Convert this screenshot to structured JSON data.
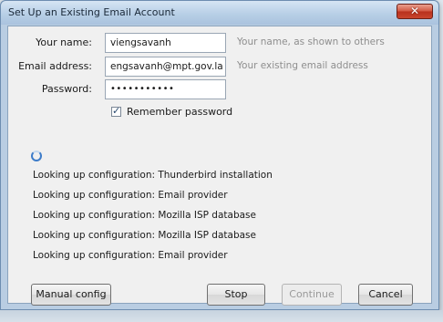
{
  "window": {
    "title": "Set Up an Existing Email Account",
    "close_glyph": "✕"
  },
  "form": {
    "name_label": "Your name:",
    "name_value": "viengsavanh",
    "name_hint": "Your name, as shown to others",
    "email_label": "Email address:",
    "email_value": "engsavanh@mpt.gov.la",
    "email_hint": "Your existing email address",
    "password_label": "Password:",
    "password_value": "•••••••••••",
    "remember_label": "Remember password",
    "remember_checked": true
  },
  "status": {
    "lines": [
      "Looking up configuration: Thunderbird installation",
      "Looking up configuration: Email provider",
      "Looking up configuration: Mozilla ISP database",
      "Looking up configuration: Mozilla ISP database",
      "Looking up configuration: Email provider"
    ]
  },
  "buttons": {
    "manual_config": "Manual config",
    "stop": "Stop",
    "continue": "Continue",
    "cancel": "Cancel"
  },
  "icons": {
    "close": "close-icon",
    "spinner": "loading-spinner-icon",
    "checkmark": "checkmark-icon"
  }
}
